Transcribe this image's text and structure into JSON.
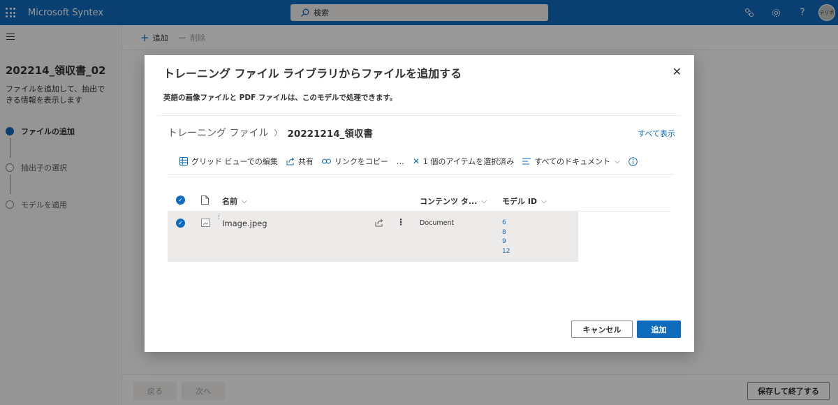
{
  "topbar": {
    "app_title": "Microsoft Syntex",
    "search_placeholder": "検索",
    "avatar_initials": "テリポ"
  },
  "sidebar": {
    "project_title": "202214_領収書_02",
    "description": "ファイルを追加して、抽出できる情報を表示します",
    "steps": [
      {
        "label": "ファイルの追加",
        "active": true
      },
      {
        "label": "抽出子の選択",
        "active": false
      },
      {
        "label": "モデルを適用",
        "active": false
      }
    ]
  },
  "commandbar": {
    "add_label": "追加",
    "delete_label": "削除"
  },
  "footer": {
    "back_label": "戻る",
    "next_label": "次へ",
    "save_label": "保存して終了する"
  },
  "dialog": {
    "title": "トレーニング ファイル ライブラリからファイルを追加する",
    "description": "英語の画像ファイルと PDF ファイルは、このモデルで処理できます。",
    "breadcrumb": {
      "root": "トレーニング ファイル",
      "current": "20221214_領収書"
    },
    "see_all": "すべて表示",
    "toolbar": {
      "grid_edit": "グリッド ビューでの編集",
      "share": "共有",
      "copy_link": "リンクをコピー",
      "more": "…",
      "selected": "1 個のアイテムを選択済み",
      "view": "すべてのドキュメント"
    },
    "columns": {
      "name": "名前",
      "content_type": "コンテンツ タ...",
      "model_id": "モデル ID"
    },
    "rows": [
      {
        "name": "Image.jpeg",
        "content_type": "Document",
        "model_ids": [
          "6",
          "8",
          "9",
          "12"
        ]
      }
    ],
    "cancel_label": "キャンセル",
    "add_label": "追加"
  },
  "colors": {
    "brand": "#0f6cbd",
    "selected_row": "#edebe9"
  }
}
